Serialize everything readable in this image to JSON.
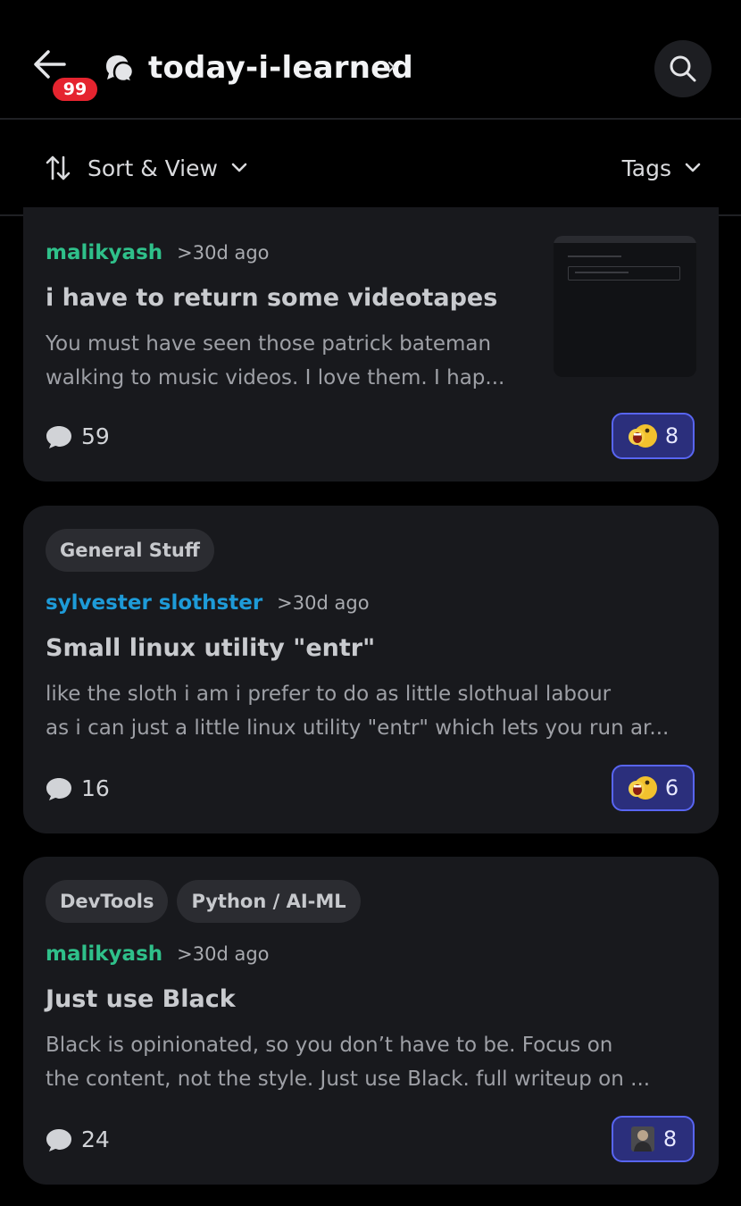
{
  "header": {
    "notification_count": "99",
    "channel_name": "today-i-learned"
  },
  "sortbar": {
    "sort_label": "Sort & View",
    "tags_label": "Tags"
  },
  "posts": [
    {
      "tags": [],
      "author": "malikyash",
      "author_color": "#2fc08a",
      "time": ">30d ago",
      "title": "i have to return some videotapes",
      "excerpt_lines": [
        "You must have seen those patrick bateman",
        "walking to music videos. I love them. I hap..."
      ],
      "comments": "59",
      "reaction_icon": "screaming-emoji-icon",
      "reaction_count": "8"
    },
    {
      "tags": [
        "General Stuff"
      ],
      "author": "sylvester slothster",
      "author_color": "#1e9bd8",
      "time": ">30d ago",
      "title": "Small linux utility \"entr\"",
      "excerpt_lines": [
        "like the sloth i am i prefer to do as little slothual labour",
        "as i can just a little linux utility \"entr\" which lets you run ar..."
      ],
      "comments": "16",
      "reaction_icon": "screaming-emoji-icon",
      "reaction_count": "6"
    },
    {
      "tags": [
        "DevTools",
        "Python / AI-ML"
      ],
      "author": "malikyash",
      "author_color": "#2fc08a",
      "time": ">30d ago",
      "title": "Just use Black",
      "excerpt_lines": [
        "Black is opinionated, so you don’t have to be. Focus on",
        "the content, not the style. Just use Black. full writeup on ..."
      ],
      "comments": "24",
      "reaction_icon": "person-emoji-icon",
      "reaction_count": "8"
    }
  ]
}
